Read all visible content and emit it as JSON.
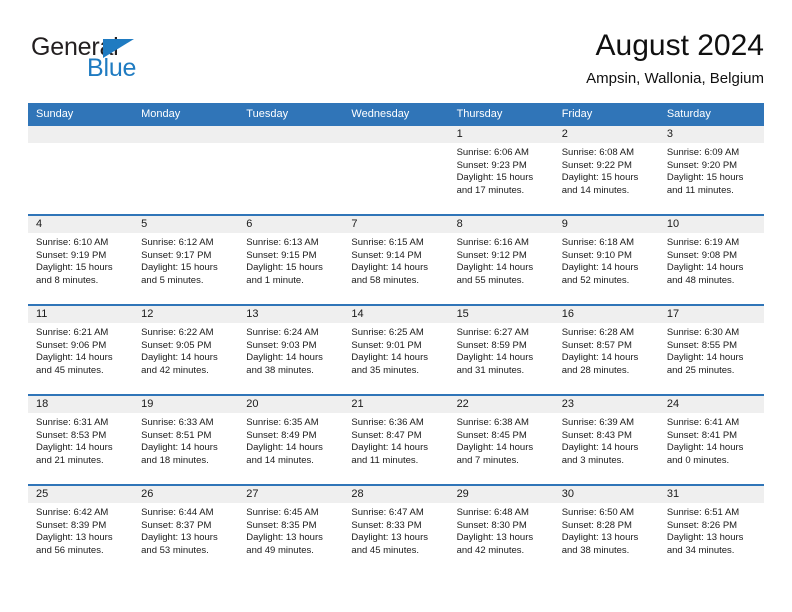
{
  "brand": {
    "name_part1": "General",
    "name_part2": "Blue",
    "triangle_color": "#1f7bc1"
  },
  "header": {
    "title": "August 2024",
    "subtitle": "Ampsin, Wallonia, Belgium"
  },
  "theme": {
    "header_blue": "#3075b8",
    "daynum_band": "#efefef",
    "text": "#1a1a1a",
    "page_background": "#ffffff"
  },
  "weekday_headers": [
    "Sunday",
    "Monday",
    "Tuesday",
    "Wednesday",
    "Thursday",
    "Friday",
    "Saturday"
  ],
  "labels": {
    "sunrise_prefix": "Sunrise:",
    "sunset_prefix": "Sunset:",
    "daylight_prefix": "Daylight:"
  },
  "weeks": [
    [
      {
        "day": "",
        "sunrise": "",
        "sunset": "",
        "daylight": "",
        "empty": true
      },
      {
        "day": "",
        "sunrise": "",
        "sunset": "",
        "daylight": "",
        "empty": true
      },
      {
        "day": "",
        "sunrise": "",
        "sunset": "",
        "daylight": "",
        "empty": true
      },
      {
        "day": "",
        "sunrise": "",
        "sunset": "",
        "daylight": "",
        "empty": true
      },
      {
        "day": "1",
        "sunrise": "Sunrise: 6:06 AM",
        "sunset": "Sunset: 9:23 PM",
        "daylight": "Daylight: 15 hours and 17 minutes.",
        "empty": false
      },
      {
        "day": "2",
        "sunrise": "Sunrise: 6:08 AM",
        "sunset": "Sunset: 9:22 PM",
        "daylight": "Daylight: 15 hours and 14 minutes.",
        "empty": false
      },
      {
        "day": "3",
        "sunrise": "Sunrise: 6:09 AM",
        "sunset": "Sunset: 9:20 PM",
        "daylight": "Daylight: 15 hours and 11 minutes.",
        "empty": false
      }
    ],
    [
      {
        "day": "4",
        "sunrise": "Sunrise: 6:10 AM",
        "sunset": "Sunset: 9:19 PM",
        "daylight": "Daylight: 15 hours and 8 minutes.",
        "empty": false
      },
      {
        "day": "5",
        "sunrise": "Sunrise: 6:12 AM",
        "sunset": "Sunset: 9:17 PM",
        "daylight": "Daylight: 15 hours and 5 minutes.",
        "empty": false
      },
      {
        "day": "6",
        "sunrise": "Sunrise: 6:13 AM",
        "sunset": "Sunset: 9:15 PM",
        "daylight": "Daylight: 15 hours and 1 minute.",
        "empty": false
      },
      {
        "day": "7",
        "sunrise": "Sunrise: 6:15 AM",
        "sunset": "Sunset: 9:14 PM",
        "daylight": "Daylight: 14 hours and 58 minutes.",
        "empty": false
      },
      {
        "day": "8",
        "sunrise": "Sunrise: 6:16 AM",
        "sunset": "Sunset: 9:12 PM",
        "daylight": "Daylight: 14 hours and 55 minutes.",
        "empty": false
      },
      {
        "day": "9",
        "sunrise": "Sunrise: 6:18 AM",
        "sunset": "Sunset: 9:10 PM",
        "daylight": "Daylight: 14 hours and 52 minutes.",
        "empty": false
      },
      {
        "day": "10",
        "sunrise": "Sunrise: 6:19 AM",
        "sunset": "Sunset: 9:08 PM",
        "daylight": "Daylight: 14 hours and 48 minutes.",
        "empty": false
      }
    ],
    [
      {
        "day": "11",
        "sunrise": "Sunrise: 6:21 AM",
        "sunset": "Sunset: 9:06 PM",
        "daylight": "Daylight: 14 hours and 45 minutes.",
        "empty": false
      },
      {
        "day": "12",
        "sunrise": "Sunrise: 6:22 AM",
        "sunset": "Sunset: 9:05 PM",
        "daylight": "Daylight: 14 hours and 42 minutes.",
        "empty": false
      },
      {
        "day": "13",
        "sunrise": "Sunrise: 6:24 AM",
        "sunset": "Sunset: 9:03 PM",
        "daylight": "Daylight: 14 hours and 38 minutes.",
        "empty": false
      },
      {
        "day": "14",
        "sunrise": "Sunrise: 6:25 AM",
        "sunset": "Sunset: 9:01 PM",
        "daylight": "Daylight: 14 hours and 35 minutes.",
        "empty": false
      },
      {
        "day": "15",
        "sunrise": "Sunrise: 6:27 AM",
        "sunset": "Sunset: 8:59 PM",
        "daylight": "Daylight: 14 hours and 31 minutes.",
        "empty": false
      },
      {
        "day": "16",
        "sunrise": "Sunrise: 6:28 AM",
        "sunset": "Sunset: 8:57 PM",
        "daylight": "Daylight: 14 hours and 28 minutes.",
        "empty": false
      },
      {
        "day": "17",
        "sunrise": "Sunrise: 6:30 AM",
        "sunset": "Sunset: 8:55 PM",
        "daylight": "Daylight: 14 hours and 25 minutes.",
        "empty": false
      }
    ],
    [
      {
        "day": "18",
        "sunrise": "Sunrise: 6:31 AM",
        "sunset": "Sunset: 8:53 PM",
        "daylight": "Daylight: 14 hours and 21 minutes.",
        "empty": false
      },
      {
        "day": "19",
        "sunrise": "Sunrise: 6:33 AM",
        "sunset": "Sunset: 8:51 PM",
        "daylight": "Daylight: 14 hours and 18 minutes.",
        "empty": false
      },
      {
        "day": "20",
        "sunrise": "Sunrise: 6:35 AM",
        "sunset": "Sunset: 8:49 PM",
        "daylight": "Daylight: 14 hours and 14 minutes.",
        "empty": false
      },
      {
        "day": "21",
        "sunrise": "Sunrise: 6:36 AM",
        "sunset": "Sunset: 8:47 PM",
        "daylight": "Daylight: 14 hours and 11 minutes.",
        "empty": false
      },
      {
        "day": "22",
        "sunrise": "Sunrise: 6:38 AM",
        "sunset": "Sunset: 8:45 PM",
        "daylight": "Daylight: 14 hours and 7 minutes.",
        "empty": false
      },
      {
        "day": "23",
        "sunrise": "Sunrise: 6:39 AM",
        "sunset": "Sunset: 8:43 PM",
        "daylight": "Daylight: 14 hours and 3 minutes.",
        "empty": false
      },
      {
        "day": "24",
        "sunrise": "Sunrise: 6:41 AM",
        "sunset": "Sunset: 8:41 PM",
        "daylight": "Daylight: 14 hours and 0 minutes.",
        "empty": false
      }
    ],
    [
      {
        "day": "25",
        "sunrise": "Sunrise: 6:42 AM",
        "sunset": "Sunset: 8:39 PM",
        "daylight": "Daylight: 13 hours and 56 minutes.",
        "empty": false
      },
      {
        "day": "26",
        "sunrise": "Sunrise: 6:44 AM",
        "sunset": "Sunset: 8:37 PM",
        "daylight": "Daylight: 13 hours and 53 minutes.",
        "empty": false
      },
      {
        "day": "27",
        "sunrise": "Sunrise: 6:45 AM",
        "sunset": "Sunset: 8:35 PM",
        "daylight": "Daylight: 13 hours and 49 minutes.",
        "empty": false
      },
      {
        "day": "28",
        "sunrise": "Sunrise: 6:47 AM",
        "sunset": "Sunset: 8:33 PM",
        "daylight": "Daylight: 13 hours and 45 minutes.",
        "empty": false
      },
      {
        "day": "29",
        "sunrise": "Sunrise: 6:48 AM",
        "sunset": "Sunset: 8:30 PM",
        "daylight": "Daylight: 13 hours and 42 minutes.",
        "empty": false
      },
      {
        "day": "30",
        "sunrise": "Sunrise: 6:50 AM",
        "sunset": "Sunset: 8:28 PM",
        "daylight": "Daylight: 13 hours and 38 minutes.",
        "empty": false
      },
      {
        "day": "31",
        "sunrise": "Sunrise: 6:51 AM",
        "sunset": "Sunset: 8:26 PM",
        "daylight": "Daylight: 13 hours and 34 minutes.",
        "empty": false
      }
    ]
  ]
}
